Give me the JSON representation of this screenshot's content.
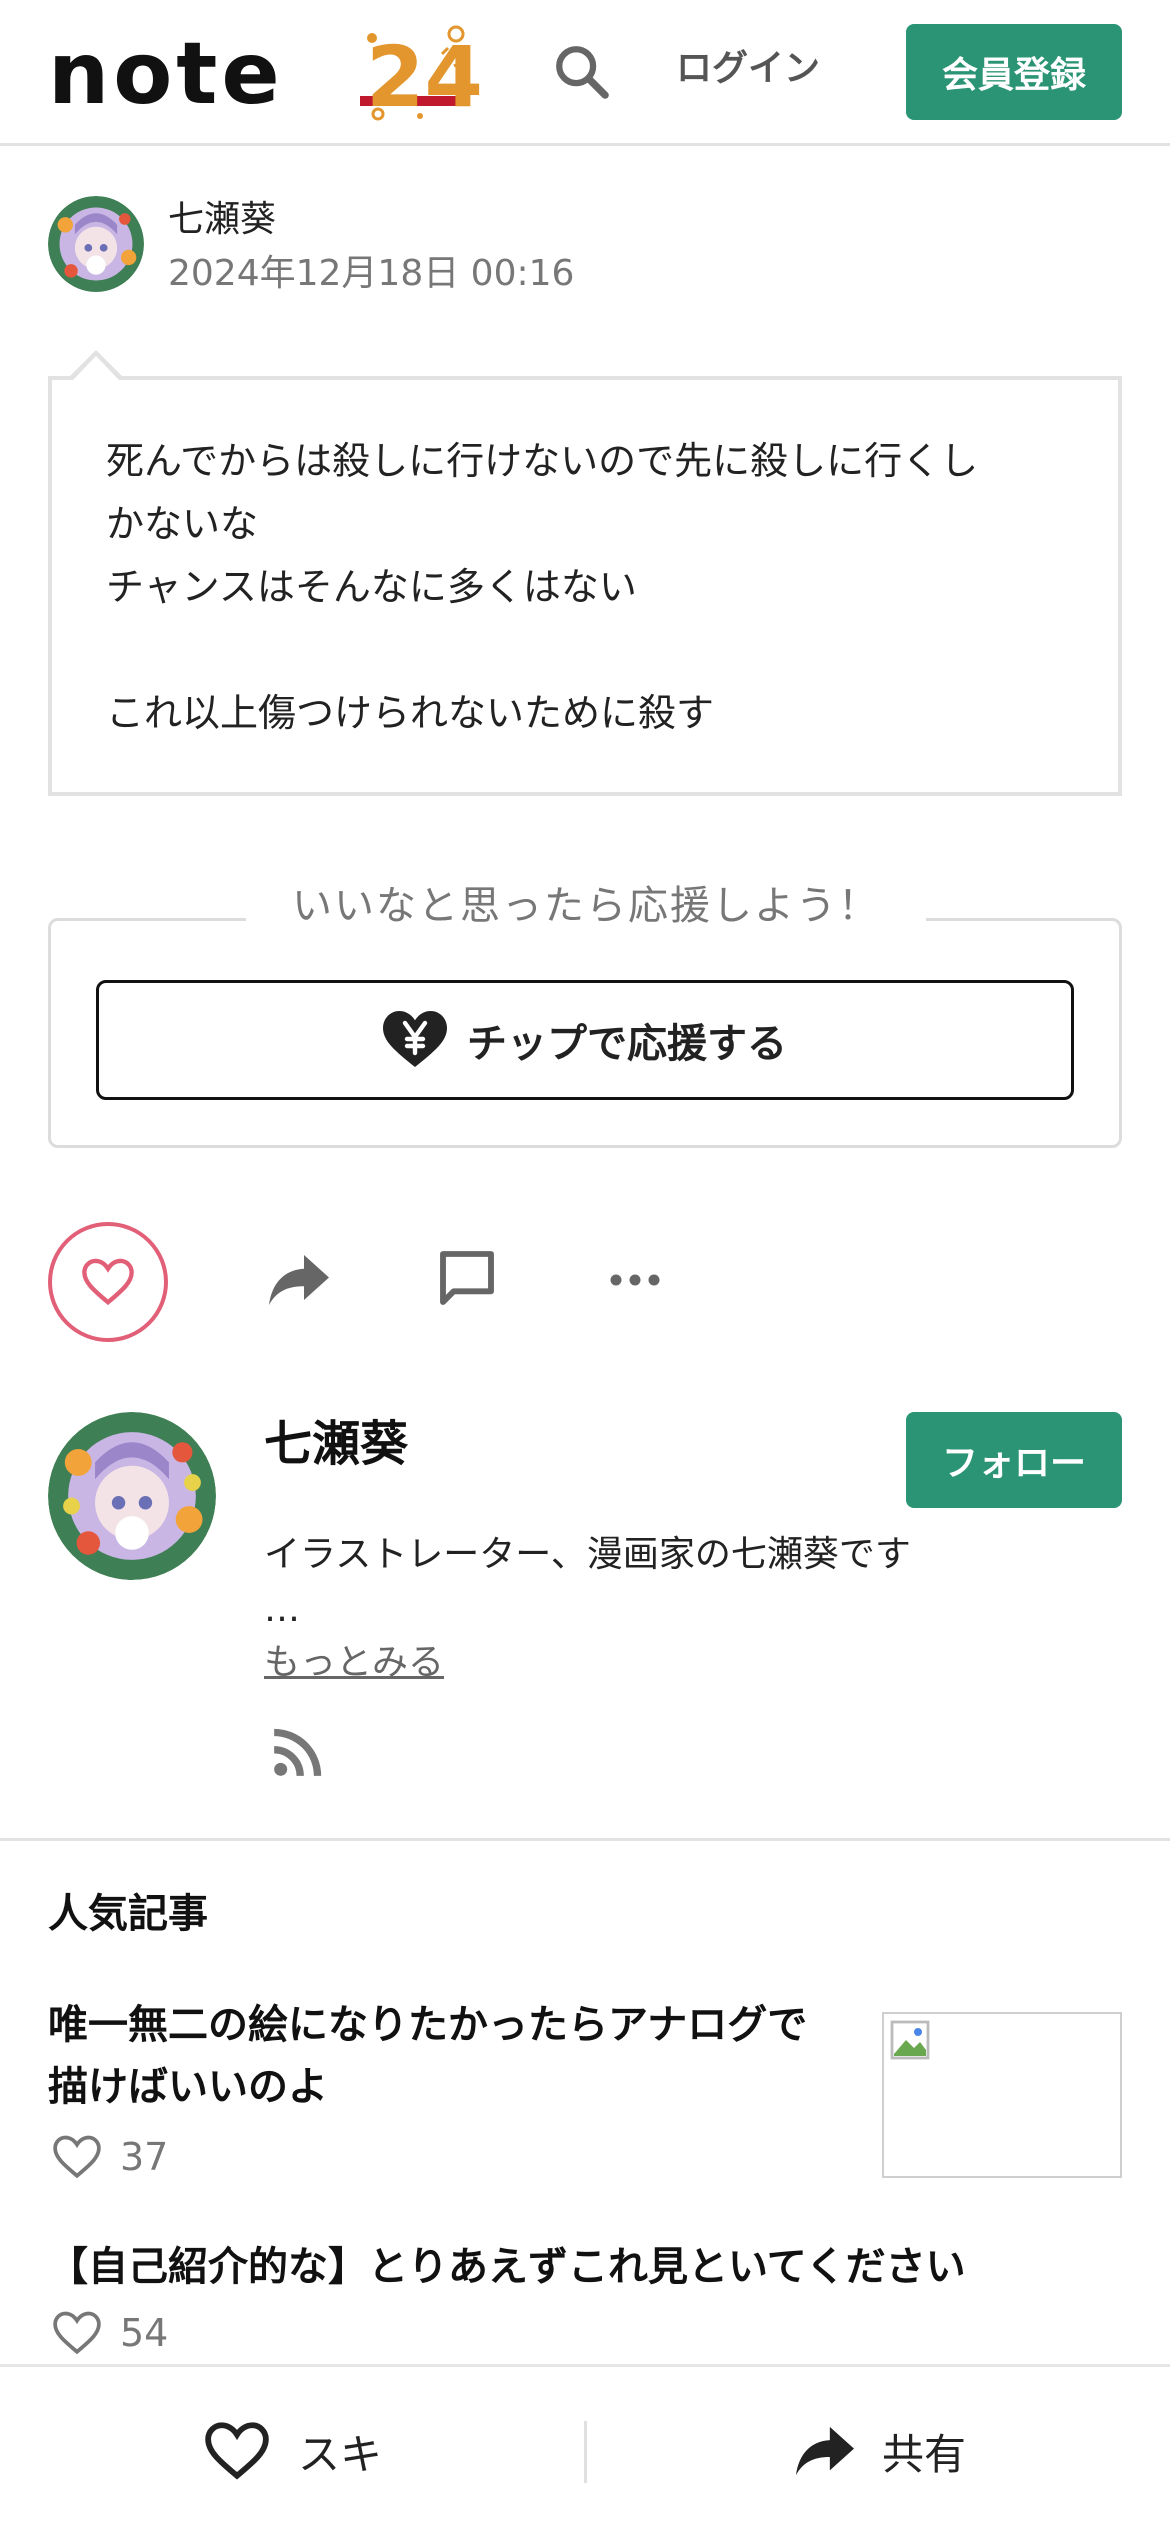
{
  "header": {
    "logo_text": "note",
    "logo_badge": "24",
    "login_label": "ログイン",
    "signup_label": "会員登録",
    "icons": {
      "search": "search-icon"
    }
  },
  "post": {
    "author": "七瀬葵",
    "date": "2024年12月18日 00:16",
    "lines": [
      "死んでからは殺しに行けないので先に殺しに行くし",
      "かないな",
      "チャンスはそんなに多くはない",
      "",
      "これ以上傷つけられないために殺す"
    ]
  },
  "support": {
    "prompt": "いいなと思ったら応援しよう！",
    "tip_label": "チップで応援する"
  },
  "actions": {
    "icons": [
      "heart-icon",
      "share-icon",
      "comment-icon",
      "more-icon"
    ]
  },
  "creator": {
    "name": "七瀬葵",
    "follow_label": "フォロー",
    "bio": "イラストレーター、漫画家の七瀬葵です",
    "ellipsis": "…",
    "more_label": "もっとみる"
  },
  "popular": {
    "heading": "人気記事",
    "articles": [
      {
        "title_line1": "唯一無二の絵になりたかったらアナログで",
        "title_line2": "描けばいいのよ",
        "likes": "37"
      },
      {
        "title_line1": "【自己紹介的な】とりあえずこれ見といてください",
        "likes": "54"
      }
    ]
  },
  "bottom_bar": {
    "like_label": "スキ",
    "share_label": "共有"
  },
  "colors": {
    "brand_green": "#2a9474",
    "like_pink": "#e25f78",
    "text": "#222222",
    "muted": "#777777"
  }
}
